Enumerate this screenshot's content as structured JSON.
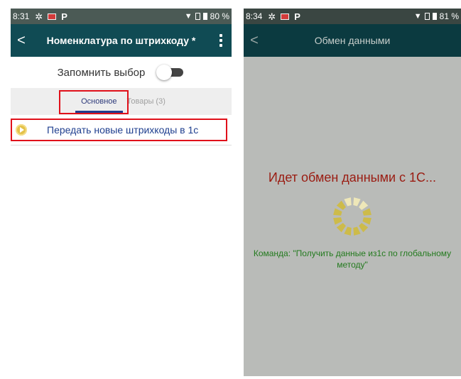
{
  "left_screen": {
    "status": {
      "time": "8:31",
      "battery": "80 %"
    },
    "appbar": {
      "title": "Номенклатура по штрихкоду *"
    },
    "remember": {
      "label": "Запомнить выбор",
      "enabled": false
    },
    "tabs": [
      {
        "label": "Основное",
        "active": true
      },
      {
        "label": "Товары (3)",
        "active": false
      }
    ],
    "actions": [
      {
        "label": "Передать новые штрихкоды в 1с"
      }
    ]
  },
  "right_screen": {
    "status": {
      "time": "8:34",
      "battery": "81 %"
    },
    "appbar": {
      "title": "Обмен данными"
    },
    "exchange": {
      "title": "Идет обмен данными с 1С...",
      "command": "Команда: \"Получить данные из1с по глобальному методу\""
    }
  },
  "colors": {
    "appbar_left": "#104b54",
    "appbar_right": "#0b3a40",
    "highlight": "#e0101a",
    "exchange_title": "#9a1c12",
    "command_text": "#237a1e"
  },
  "icons": [
    "back-icon",
    "kebab-menu-icon",
    "gear-icon",
    "wifi-icon",
    "battery-icon",
    "play-icon",
    "spinner-icon"
  ]
}
